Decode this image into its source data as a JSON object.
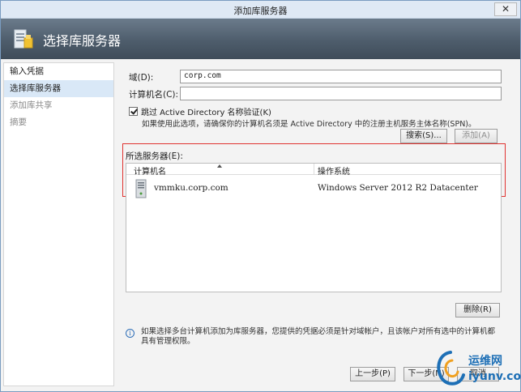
{
  "window": {
    "title": "添加库服务器",
    "close_glyph": "✕"
  },
  "banner": {
    "title": "选择库服务器"
  },
  "nav": {
    "items": [
      {
        "label": "输入凭据"
      },
      {
        "label": "选择库服务器"
      },
      {
        "label": "添加库共享"
      },
      {
        "label": "摘要"
      }
    ]
  },
  "form": {
    "domain_label": "域(D):",
    "domain_value": "corp.com",
    "computer_label": "计算机名(C):",
    "computer_value": "",
    "skip_ad_label": "跳过 Active Directory 名称验证(K)",
    "hint": "如果使用此选项，请确保你的计算机名须是 Active Directory 中的注册主机服务主体名称(SPN)。",
    "search_button": "搜索(S)...",
    "add_button": "添加(A)"
  },
  "selected_servers": {
    "label": "所选服务器(E):",
    "columns": [
      "计算机名",
      "操作系统"
    ],
    "rows": [
      {
        "name": "vmmku.corp.com",
        "os": "Windows Server 2012 R2 Datacenter"
      }
    ],
    "remove_button": "删除(R)"
  },
  "info": {
    "text": "如果选择多台计算机添加为库服务器，您提供的凭据必须是针对域帐户，且该帐户对所有选中的计算机都具有管理权限。"
  },
  "footer": {
    "prev_button": "上一步(P)",
    "next_button": "下一步(N)",
    "cancel_button": "取消"
  },
  "watermark": {
    "name": "运维网",
    "url": "iyunv.com"
  },
  "colors": {
    "highlight": "#e0322f",
    "banner": "#4e5d6c",
    "accent": "#1d6fb6"
  }
}
